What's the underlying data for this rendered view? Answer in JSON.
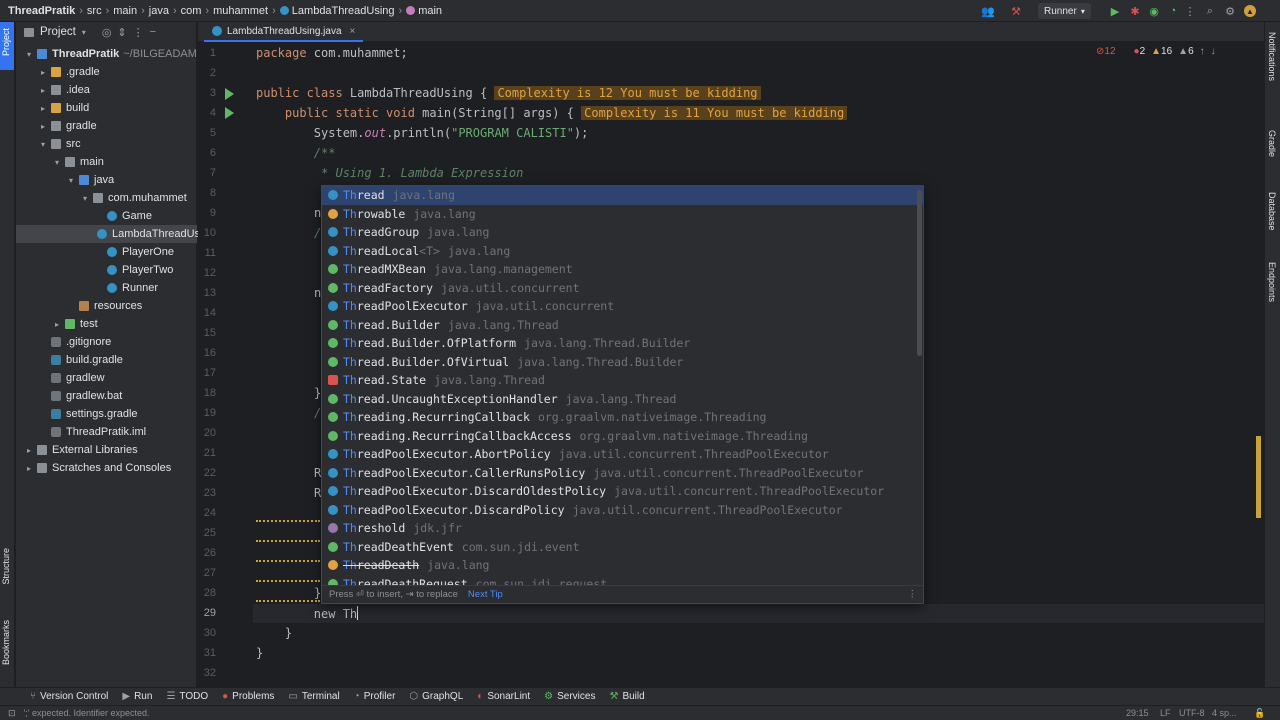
{
  "breadcrumbs": [
    "ThreadPratik",
    "src",
    "main",
    "java",
    "com",
    "muhammet",
    "LambdaThreadUsing",
    "main"
  ],
  "run_config": "Runner",
  "left_stripe": {
    "project": "Project",
    "structure": "Structure",
    "bookmarks": "Bookmarks"
  },
  "right_stripe": {
    "notifications": "Notifications",
    "gradle": "Gradle",
    "database": "Database",
    "endpoints": "Endpoints"
  },
  "project_panel": {
    "title": "Project",
    "tree": [
      {
        "label": "ThreadPratik",
        "extra": "~/BILGEADAM",
        "indent": 0,
        "arrow": "▾",
        "icon": "folder-blue"
      },
      {
        "label": ".gradle",
        "indent": 1,
        "arrow": "▸",
        "icon": "folder"
      },
      {
        "label": ".idea",
        "indent": 1,
        "arrow": "▸",
        "icon": "folder-gray"
      },
      {
        "label": "build",
        "indent": 1,
        "arrow": "▸",
        "icon": "folder"
      },
      {
        "label": "gradle",
        "indent": 1,
        "arrow": "▸",
        "icon": "folder-gray"
      },
      {
        "label": "src",
        "indent": 1,
        "arrow": "▾",
        "icon": "folder-gray"
      },
      {
        "label": "main",
        "indent": 2,
        "arrow": "▾",
        "icon": "folder-gray"
      },
      {
        "label": "java",
        "indent": 3,
        "arrow": "▾",
        "icon": "folder-blue"
      },
      {
        "label": "com.muhammet",
        "indent": 4,
        "arrow": "▾",
        "icon": "folder-gray"
      },
      {
        "label": "Game",
        "indent": 5,
        "arrow": "",
        "icon": "cls"
      },
      {
        "label": "LambdaThreadUsing",
        "indent": 5,
        "arrow": "",
        "icon": "cls",
        "selected": true
      },
      {
        "label": "PlayerOne",
        "indent": 5,
        "arrow": "",
        "icon": "cls"
      },
      {
        "label": "PlayerTwo",
        "indent": 5,
        "arrow": "",
        "icon": "cls"
      },
      {
        "label": "Runner",
        "indent": 5,
        "arrow": "",
        "icon": "cls"
      },
      {
        "label": "resources",
        "indent": 3,
        "arrow": "",
        "icon": "folder-res"
      },
      {
        "label": "test",
        "indent": 2,
        "arrow": "▸",
        "icon": "folder-green"
      },
      {
        "label": ".gitignore",
        "indent": 1,
        "arrow": "",
        "icon": "file"
      },
      {
        "label": "build.gradle",
        "indent": 1,
        "arrow": "",
        "icon": "gradlefile"
      },
      {
        "label": "gradlew",
        "indent": 1,
        "arrow": "",
        "icon": "file"
      },
      {
        "label": "gradlew.bat",
        "indent": 1,
        "arrow": "",
        "icon": "file"
      },
      {
        "label": "settings.gradle",
        "indent": 1,
        "arrow": "",
        "icon": "gradlefile"
      },
      {
        "label": "ThreadPratik.iml",
        "indent": 1,
        "arrow": "",
        "icon": "file"
      },
      {
        "label": "External Libraries",
        "indent": 0,
        "arrow": "▸",
        "icon": "folder-gray"
      },
      {
        "label": "Scratches and Consoles",
        "indent": 0,
        "arrow": "▸",
        "icon": "folder-gray"
      }
    ]
  },
  "editor": {
    "tab_label": "LambdaThreadUsing.java",
    "inspections": {
      "warnings_count": "12",
      "errors": "2",
      "warnings": "16",
      "weak": "6"
    },
    "line_numbers": [
      "1",
      "2",
      "3",
      "4",
      "5",
      "6",
      "7",
      "8",
      "9",
      "10",
      "11",
      "12",
      "13",
      "14",
      "15",
      "16",
      "17",
      "18",
      "19",
      "20",
      "21",
      "22",
      "23",
      "24",
      "25",
      "26",
      "27",
      "28",
      "29",
      "30",
      "31",
      "32"
    ],
    "lines": {
      "l1_a": "package",
      "l1_b": " com.muhammet;",
      "l3_a": "public class",
      "l3_b": " LambdaThreadUsing {",
      "l3_hint": "Complexity is 12 You must be kidding",
      "l4_a": "    public static void",
      "l4_b": " main(String[] args) {",
      "l4_hint": "Complexity is 11 You must be kidding",
      "l5_a": "        System.",
      "l5_b": "out",
      "l5_c": ".println(",
      "l5_d": "\"PROGRAM CALISTI\"",
      "l5_e": ");",
      "l6": "        /**",
      "l7": "         * Using 1. Lambda Expression",
      "l29_a": "        new ",
      "l29_b": "Th",
      "l30": "    }",
      "l31": "}"
    },
    "left_fragments": [
      "n",
      "/",
      "n",
      "}",
      "/",
      "R",
      "R",
      "}"
    ]
  },
  "completion": {
    "items": [
      {
        "prefix": "Th",
        "rest": "read",
        "pkg": "java.lang",
        "icon": "class",
        "selected": true
      },
      {
        "prefix": "Th",
        "rest": "rowable",
        "pkg": "java.lang",
        "icon": "exception"
      },
      {
        "prefix": "Th",
        "rest": "readGroup",
        "pkg": "java.lang",
        "icon": "class"
      },
      {
        "prefix": "Th",
        "rest": "readLocal",
        "generic": "<T>",
        "pkg": "java.lang",
        "icon": "class"
      },
      {
        "prefix": "Th",
        "rest": "readMXBean",
        "pkg": "java.lang.management",
        "icon": "interface"
      },
      {
        "prefix": "Th",
        "rest": "readFactory",
        "pkg": "java.util.concurrent",
        "icon": "interface"
      },
      {
        "prefix": "Th",
        "rest": "readPoolExecutor",
        "pkg": "java.util.concurrent",
        "icon": "class"
      },
      {
        "prefix": "Th",
        "rest": "read.Builder",
        "pkg": "java.lang.Thread",
        "icon": "interface"
      },
      {
        "prefix": "Th",
        "rest": "read.Builder.OfPlatform",
        "pkg": "java.lang.Thread.Builder",
        "icon": "interface"
      },
      {
        "prefix": "Th",
        "rest": "read.Builder.OfVirtual",
        "pkg": "java.lang.Thread.Builder",
        "icon": "interface"
      },
      {
        "prefix": "Th",
        "rest": "read.State",
        "pkg": "java.lang.Thread",
        "icon": "enum"
      },
      {
        "prefix": "Th",
        "rest": "read.UncaughtExceptionHandler",
        "pkg": "java.lang.Thread",
        "icon": "interface"
      },
      {
        "prefix": "Th",
        "rest": "reading.RecurringCallback",
        "pkg": "org.graalvm.nativeimage.Threading",
        "icon": "interface"
      },
      {
        "prefix": "Th",
        "rest": "reading.RecurringCallbackAccess",
        "pkg": "org.graalvm.nativeimage.Threading",
        "icon": "interface"
      },
      {
        "prefix": "Th",
        "rest": "readPoolExecutor.AbortPolicy",
        "pkg": "java.util.concurrent.ThreadPoolExecutor",
        "icon": "class"
      },
      {
        "prefix": "Th",
        "rest": "readPoolExecutor.CallerRunsPolicy",
        "pkg": "java.util.concurrent.ThreadPoolExecutor",
        "icon": "class"
      },
      {
        "prefix": "Th",
        "rest": "readPoolExecutor.DiscardOldestPolicy",
        "pkg": "java.util.concurrent.ThreadPoolExecutor",
        "icon": "class"
      },
      {
        "prefix": "Th",
        "rest": "readPoolExecutor.DiscardPolicy",
        "pkg": "java.util.concurrent.ThreadPoolExecutor",
        "icon": "class"
      },
      {
        "prefix": "Th",
        "rest": "reshold",
        "pkg": "jdk.jfr",
        "icon": "annotation"
      },
      {
        "prefix": "Th",
        "rest": "readDeathEvent",
        "pkg": "com.sun.jdi.event",
        "icon": "interface"
      },
      {
        "prefix": "Th",
        "rest": "readDeath",
        "pkg": "java.lang",
        "icon": "exception",
        "deprecated": true
      },
      {
        "prefix": "Th",
        "rest": "readDeathRequest",
        "pkg": "com.sun.jdi.request",
        "icon": "interface"
      }
    ],
    "footer_text": "Press ⏎ to insert, ⇥ to replace",
    "footer_link": "Next Tip",
    "colors": {
      "class": "#3592c4",
      "interface": "#5fb865",
      "exception": "#e0a243",
      "enum": "#d9534f",
      "annotation": "#9876aa"
    }
  },
  "bottom_tools": [
    "Version Control",
    "Run",
    "TODO",
    "Problems",
    "Terminal",
    "Profiler",
    "GraphQL",
    "SonarLint",
    "Services",
    "Build"
  ],
  "status": {
    "message": "';' expected. Identifier expected.",
    "position": "29:15",
    "line_sep": "LF",
    "encoding": "UTF-8",
    "indent": "4 sp..."
  }
}
